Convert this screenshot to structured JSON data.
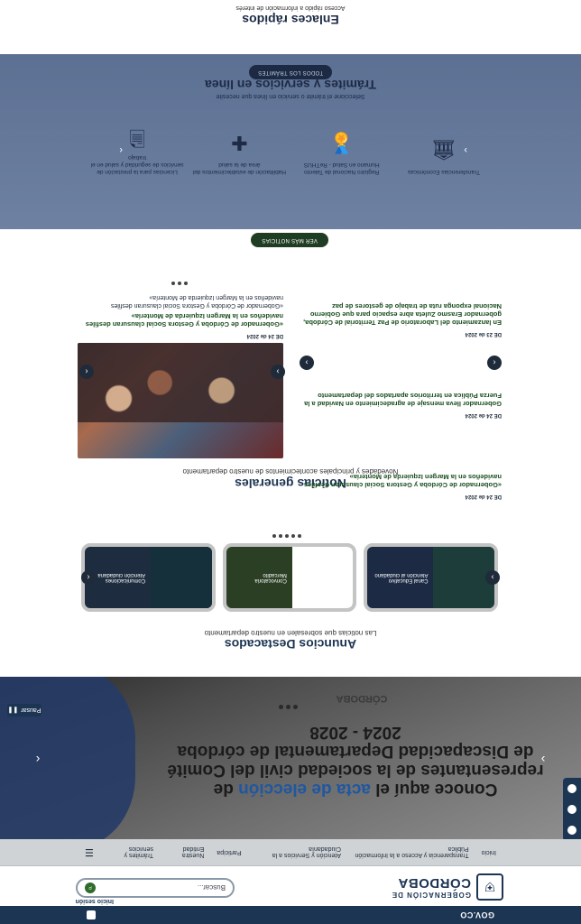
{
  "topbar": {
    "gov_label": "GOV.CO"
  },
  "header": {
    "access_link": "Inicio sesión",
    "search_placeholder": "Buscar...",
    "logo_line1": "GOBERNACIÓN DE",
    "logo_line2": "CÓRDOBA"
  },
  "nav": {
    "items": [
      "Inicio",
      "Transparencia y Acceso a la Información Pública",
      "Atención y Servicios a la Ciudadanía",
      "Participa",
      "Nuestra Entidad",
      "Trámites y servicios"
    ]
  },
  "hero": {
    "title_pre": "Conoce aquí el",
    "title_highlight": "acta de elección",
    "title_post": "de representantes de la sociedad civil del Comité de Discapacidad Departamental de córdoba 2024 - 2028",
    "logo_text": "CÓRDOBA",
    "pause_label": "Pausar"
  },
  "anuncios": {
    "title": "Anuncios Destacados",
    "subtitle": "Las noticias que sobresalen en nuestro departamento",
    "cards": [
      {
        "text": "Comunicaciones Atención ciudadana"
      },
      {
        "text": "Convocatoria Mercadito"
      },
      {
        "text": "Canal Educativo Atención al ciudadano"
      }
    ]
  },
  "noticias": {
    "title": "Noticias generales",
    "subtitle": "Novedades y principales acontecimientos de nuestro departamento",
    "items": [
      {
        "date": "DE 24 de 2024",
        "title": "«Gobernador de Córdoba y Gestora Social clausuran desfiles navideños en la Margen Izquierda de Montería»",
        "body": "«Gobernador de Córdoba y Gestora Social clausuran desfiles navideños en la Margen Izquierda de Montería»"
      },
      {
        "date": "DE 24 de 2024",
        "title": "Gobernador lleva mensaje de agradecimiento en Navidad a la Fuerza Pública en territorios apartados del departamento",
        "body": "Gobernador lleva mensaje de agradecimiento en Navidad a la Fuerza Pública en territorios apartados del departamento"
      },
      {
        "date": "DE 23 de 2024",
        "title": "En lanzamiento del Laboratorio de Paz Territorial de Córdoba, gobernador Erasmo Zuleta abre espacio para que Gobierno Nacional exponga ruta de trabajo de gestores de paz",
        "body": "En lanzamiento del Laboratorio de Paz Territorial de Córdoba, gobernador Erasmo Zuleta abre espacio para que Gobierno Nacional exponga ruta de trabajo de gestores de paz"
      }
    ],
    "featured": {
      "date": "DE 24 de 2024",
      "title": "«Gobernador de Córdoba y Gestora Social clausuran desfiles navideños en la Margen Izquierda de Montería»",
      "body": "«Gobernador de Córdoba y Gestora Social clausuran desfiles navideños en la Margen Izquierda de Montería»"
    },
    "more_button": "VER MÁS NOTICIAS"
  },
  "tramites": {
    "title": "Trámites y servicios en línea",
    "subtitle": "Seleccione el trámite o servicio en línea que necesite",
    "items": [
      {
        "icon": "document-icon",
        "label": "Licencias para la prestación de servicios de seguridad y salud en el trabajo"
      },
      {
        "icon": "medical-cross-icon",
        "label": "Habilitación de establecimientos del área de la salud"
      },
      {
        "icon": "medal-icon",
        "label": "Registro Nacional de Talento Humano en Salud - ReTHUS"
      },
      {
        "icon": "bank-icon",
        "label": "Transferencias Económicas"
      }
    ],
    "all_button": "TODOS LOS TRÁMITES"
  },
  "enlaces": {
    "title": "Enlaces rápidos",
    "subtitle": "Acceso rápido a información de interés"
  },
  "colors": {
    "primary": "#1c3553",
    "green": "#1f3d23",
    "tramites_bg": "#6e81a2",
    "highlight": "#1f57a0"
  }
}
